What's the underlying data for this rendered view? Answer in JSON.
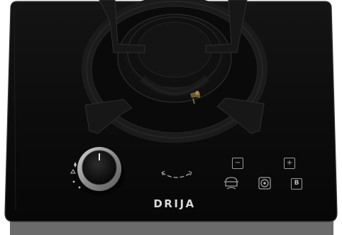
{
  "brand": {
    "name": "DRIJA"
  },
  "appliance": {
    "type": "single-burner-gas-hob",
    "surface_color": "#0b0b0b",
    "trim_color": "#3a3a3a"
  },
  "control_knob": {
    "icon": "flame-control-knob",
    "ring_color": "#a8a8a8",
    "level_markers": [
      "flame-max-icon",
      "flame-min-icon",
      "dot-marker",
      "dot-marker"
    ]
  },
  "touch_panel": {
    "minus_key": {
      "icon": "minus-icon",
      "glyph": "−"
    },
    "plus_key": {
      "icon": "plus-icon",
      "glyph": "+"
    },
    "cook_key": {
      "icon": "pot-icon"
    },
    "timer_key": {
      "icon": "target-icon"
    },
    "booster_key": {
      "icon": "booster-b-icon",
      "glyph": "B"
    },
    "swipe_indicator": {
      "icon": "swipe-arc-icon"
    }
  }
}
